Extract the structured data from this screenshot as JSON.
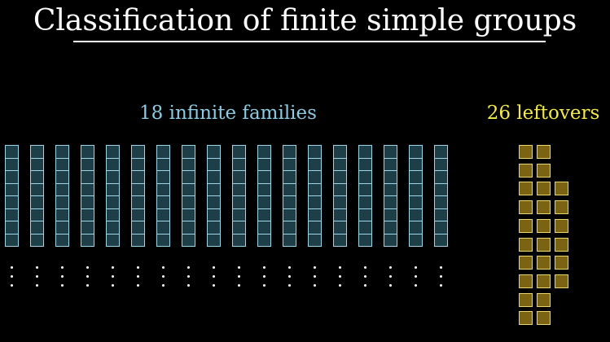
{
  "title": "Classification of finite simple groups",
  "families": {
    "label": "18 infinite families",
    "count": 18,
    "cells_per_column": 8,
    "label_color": "#8ccbe3",
    "fill_color": "#1f3f48",
    "border_color": "#9fd3e6"
  },
  "leftovers": {
    "label": "26 leftovers",
    "count": 26,
    "label_color": "#f2ea4a",
    "fill_color": "#7a6414",
    "border_color": "#e9d56c",
    "rows": [
      2,
      2,
      3,
      3,
      3,
      3,
      3,
      3,
      2,
      2
    ]
  },
  "ellipsis_color": "#ffffff"
}
